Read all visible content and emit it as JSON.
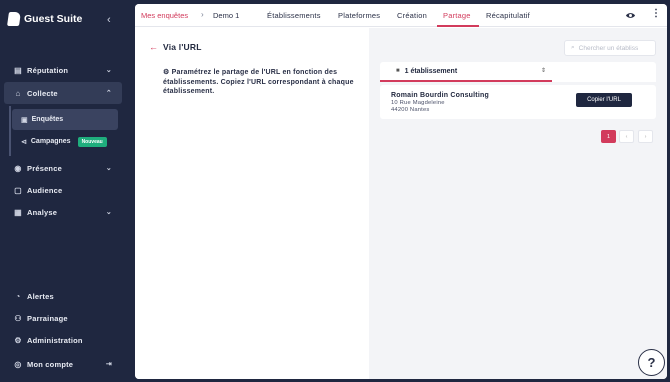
{
  "app": {
    "name": "Guest Suite"
  },
  "sidebar": {
    "items": [
      {
        "label": "Réputation",
        "icon": "chat-icon",
        "chevron": "⌄"
      },
      {
        "label": "Collecte",
        "icon": "lock-icon",
        "chevron": "⌃"
      },
      {
        "label": "Présence",
        "icon": "pin-icon",
        "chevron": "⌄"
      },
      {
        "label": "Audience",
        "icon": "chat-icon",
        "chevron": ""
      },
      {
        "label": "Analyse",
        "icon": "chart-icon",
        "chevron": "⌄"
      },
      {
        "label": "Alertes",
        "icon": "bell-icon",
        "chevron": ""
      },
      {
        "label": "Parrainage",
        "icon": "users-icon",
        "chevron": ""
      },
      {
        "label": "Administration",
        "icon": "gear-icon",
        "chevron": ""
      },
      {
        "label": "Mon compte",
        "icon": "user-icon",
        "chevron": ""
      }
    ],
    "sub": [
      {
        "label": "Enquêtes",
        "icon": "doc-icon"
      },
      {
        "label": "Campagnes",
        "icon": "megaphone-icon",
        "badge": "Nouveau"
      }
    ]
  },
  "breadcrumb": {
    "parent": "Mes enquêtes",
    "separator": "›",
    "current": "Demo 1"
  },
  "tabs": [
    "Établissements",
    "Plateformes",
    "Création",
    "Partage",
    "Récapitulatif"
  ],
  "active_tab": "Partage",
  "panel": {
    "title": "Via l'URL",
    "description": "Paramétrez le partage de l'URL en fonction des établissements. Copiez l'URL correspondant à chaque établissement."
  },
  "search": {
    "placeholder": "Chercher un établiss"
  },
  "filter": {
    "label": "1 établissement"
  },
  "establishment": {
    "name": "Romain Bourdin Consulting",
    "street": "10 Rue Magdeleine",
    "city": "44200 Nantes",
    "button": "Copier l'URL"
  },
  "pagination": {
    "current": "1",
    "prev": "‹",
    "next": "›"
  },
  "help": "?",
  "colors": {
    "accent": "#d23b5c",
    "sidebar": "#1f2740",
    "success": "#1fae7d"
  }
}
